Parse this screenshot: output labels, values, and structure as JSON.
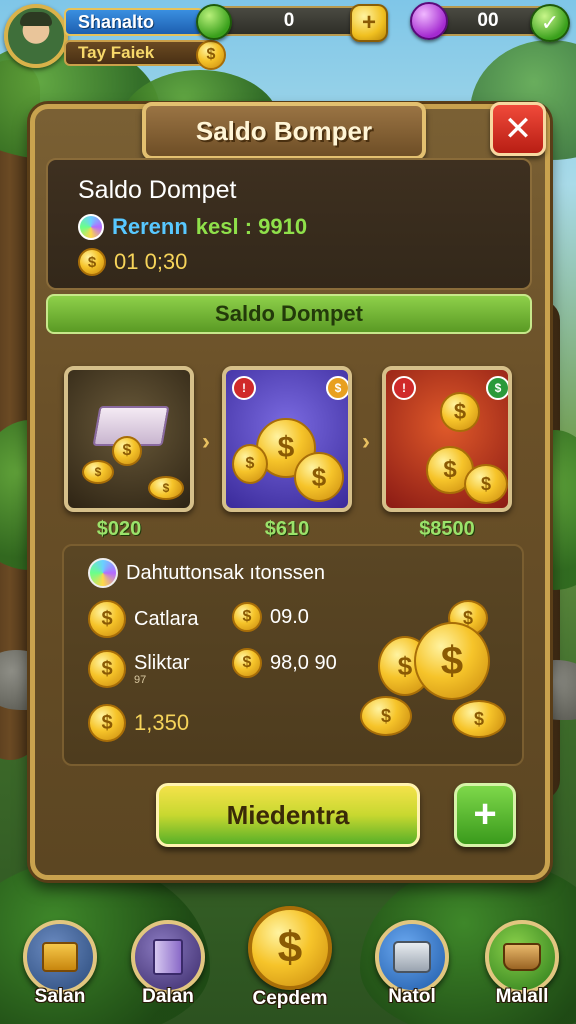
{
  "hud": {
    "player_name": "Shanalto",
    "player_tag": "Tay Faiek",
    "resource_1_value": "0",
    "resource_2_value": "00"
  },
  "panel": {
    "title": "Saldo Bomper",
    "close_glyph": "✕",
    "info": {
      "heading": "Saldo Dompet",
      "reward_label": "Rerenn",
      "reward_value": "kesl : 9910",
      "balance_value": "01 0;30"
    },
    "section_banner": "Saldo Dompet",
    "packs": [
      {
        "price": "$020",
        "icon": "cash-stack-icon"
      },
      {
        "price": "$610",
        "icon": "coin-pile-icon"
      },
      {
        "price": "$8500",
        "icon": "coin-chest-icon"
      }
    ],
    "stats": {
      "heading": "Dahtuttonsak ıtonssen",
      "row1_label": "Catlara",
      "row1_value": "09.0",
      "row2_label": "Sliktar",
      "row2_sub": "97",
      "row2_value": "98,0 90",
      "row3_value": "1,350"
    },
    "primary_button": "Miedentra",
    "plus_button": "+"
  },
  "nav": [
    {
      "label": "Salan",
      "icon": "treasure-box-icon",
      "color": "#3a5a8a"
    },
    {
      "label": "Dalan",
      "icon": "scroll-icon",
      "color": "#5a4a8a"
    },
    {
      "label": "Cepdem",
      "icon": "dollar-coin-icon",
      "color": "#d99a10"
    },
    {
      "label": "Natol",
      "icon": "safe-icon",
      "color": "#2a6ab0"
    },
    {
      "label": "Malall",
      "icon": "basket-icon",
      "color": "#3a8a2a"
    }
  ],
  "colors": {
    "panel_border": "#c9a24e",
    "banner_green": "#5a9a24",
    "close_red": "#d02a1c",
    "price_green": "#9be26a"
  }
}
